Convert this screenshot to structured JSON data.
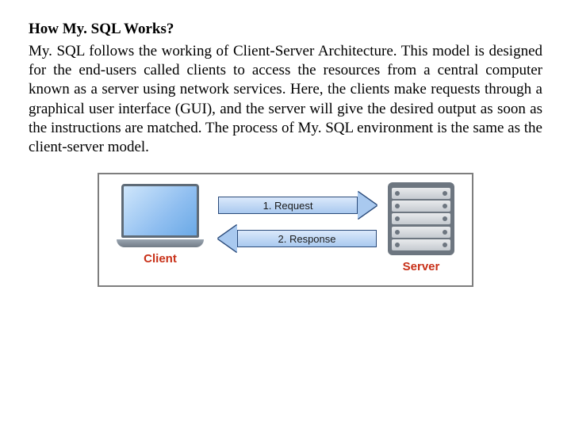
{
  "heading": "How My. SQL Works?",
  "paragraph": "My. SQL follows the working of Client-Server Architecture. This model is designed for the end-users called clients to access the resources from a central computer known as a server using network services. Here, the clients make requests through a graphical user interface (GUI), and the server will give the desired output as soon as the instructions are matched. The process of My. SQL environment is the same as the client-server model.",
  "diagram": {
    "client_label": "Client",
    "server_label": "Server",
    "request_label": "1. Request",
    "response_label": "2. Response"
  }
}
